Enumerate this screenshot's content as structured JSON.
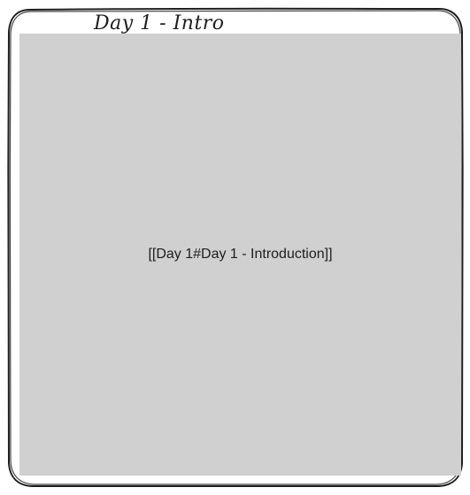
{
  "frame": {
    "title": "Day 1 - Intro",
    "border_color": "#1e1e1e"
  },
  "embed": {
    "link_text": "[[Day 1#Day 1 - Introduction]]",
    "background_color": "#d0d0d0"
  }
}
